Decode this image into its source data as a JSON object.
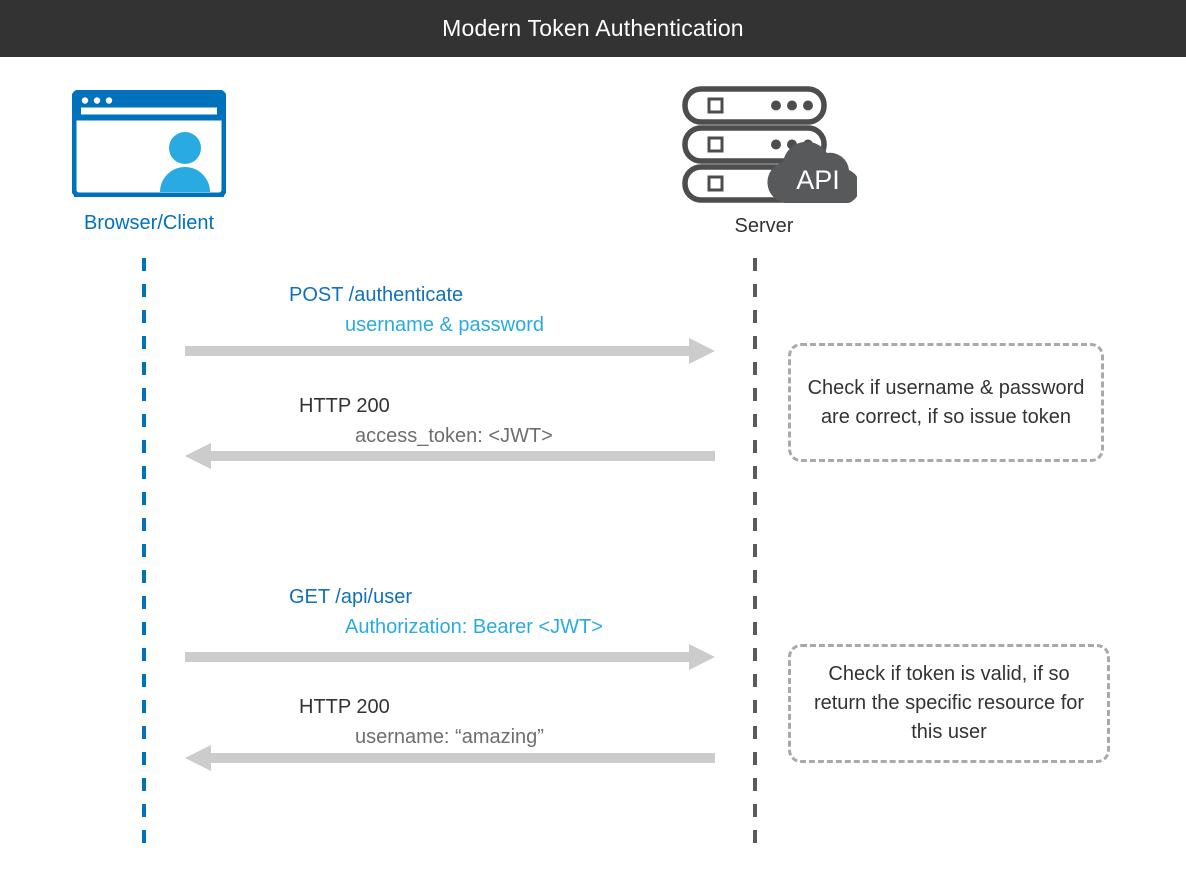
{
  "header": {
    "title": "Modern Token Authentication",
    "background_color": "#333333",
    "text_color": "#ffffff"
  },
  "palette": {
    "brand_blue": "#0072bc",
    "light_blue": "#29abe2",
    "request_blue": "#1271b8",
    "arrow_gray": "#cccccc",
    "server_gray": "#5a5a5a",
    "note_border_gray": "#a7a9ac",
    "text_dark": "#333333",
    "text_muted": "#6d6e71"
  },
  "actors": [
    {
      "id": "client",
      "label": "Browser/Client",
      "icon": "browser-window-user-icon",
      "color": "#0072bc"
    },
    {
      "id": "server",
      "label": "Server",
      "icon": "server-rack-api-cloud-icon",
      "cloud_label": "API",
      "color": "#333333"
    }
  ],
  "messages": [
    {
      "id": "post-authenticate",
      "direction": "request",
      "line1": "POST /authenticate",
      "line2": "username & password"
    },
    {
      "id": "auth-response",
      "direction": "response",
      "line1": "HTTP 200",
      "line2": "access_token: <JWT>"
    },
    {
      "id": "get-api-user",
      "direction": "request",
      "line1": "GET /api/user",
      "line2": "Authorization: Bearer <JWT>"
    },
    {
      "id": "user-response",
      "direction": "response",
      "line1": "HTTP 200",
      "line2": "username: “amazing”"
    }
  ],
  "notes": [
    {
      "id": "note-verify-credentials",
      "text": "Check if username & password are correct, if so issue token"
    },
    {
      "id": "note-verify-token",
      "text": "Check if token is valid, if so return the specific resource for this user"
    }
  ]
}
